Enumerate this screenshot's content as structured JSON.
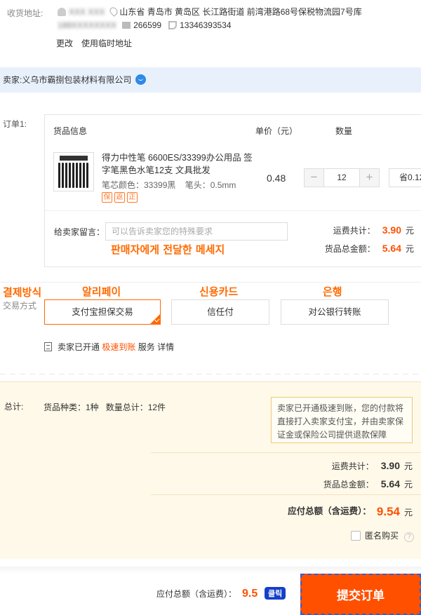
{
  "address": {
    "label": "收货地址:",
    "recipient_name": "XXX XXX",
    "region": "山东省 青岛市 黄岛区 长江路街道 前湾港路68号保税物流园7号库",
    "phone_blur": "188XXXXXXXX",
    "postcode": "266599",
    "phone": "13346393534",
    "change_link": "更改",
    "temp_link": "使用临时地址"
  },
  "seller": {
    "prefix": "卖家:",
    "name": "义乌市霸捌包装材料有限公司"
  },
  "order": {
    "label": "订单1:",
    "col_goods": "货品信息",
    "col_price": "单价（元）",
    "col_qty": "数量",
    "product_title": "得力中性笔 6600ES/33399办公用品 签字笔黑色水笔12支 文具批发",
    "spec_color": "笔芯颜色：33399黑",
    "spec_tip": "笔头：0.5mm",
    "badges": [
      "保",
      "返",
      "正"
    ],
    "unit_price": "0.48",
    "qty_minus": "−",
    "qty_value": "12",
    "qty_plus": "+",
    "save_text": "省0.12",
    "msg_label": "给卖家留言：",
    "msg_placeholder": "可以告诉卖家您的特殊要求",
    "msg_korean": "판매자에게 전달한 메세지",
    "shipping_label": "运费共计：",
    "shipping_value": "3.90",
    "goods_total_label": "货品总金额：",
    "goods_total_value": "5.64",
    "currency": "元"
  },
  "payment": {
    "korean_title": "결제방식",
    "label": "交易方式",
    "options": [
      {
        "label": "支付宝担保交易",
        "korean": "알리페이",
        "selected": true
      },
      {
        "label": "信任付",
        "korean": "신용카드",
        "selected": false
      },
      {
        "label": "对公银行转账",
        "korean": "은행",
        "selected": false
      }
    ],
    "notice_prefix": "卖家已开通",
    "notice_highlight": "极速到账",
    "notice_suffix": "服务",
    "notice_link": "详情"
  },
  "summary": {
    "label": "总计:",
    "kinds": "货品种类：1种",
    "count": "数量总计：12件",
    "tip": "卖家已开通极速到账，您的付款将直接打入卖家支付宝，并由卖家保证金或保险公司提供退款保障",
    "shipping_label": "运费共计：",
    "shipping_value": "3.90",
    "goods_label": "货品总金额：",
    "goods_value": "5.64",
    "total_label": "应付总额（含运费）：",
    "total_value": "9.54",
    "currency": "元",
    "anonymous": "匿名购买",
    "help": "?"
  },
  "footer": {
    "total_label": "应付总额（含运费）：",
    "total_value": "9.5",
    "click_badge": "클릭",
    "submit": "提交订单"
  },
  "colors": {
    "accent": "#ff5000",
    "seller_bar": "#e8f1fb",
    "summary_bg": "#fff9e9",
    "korean_annotation": "#ff6a00",
    "click_badge": "#1540c8"
  }
}
